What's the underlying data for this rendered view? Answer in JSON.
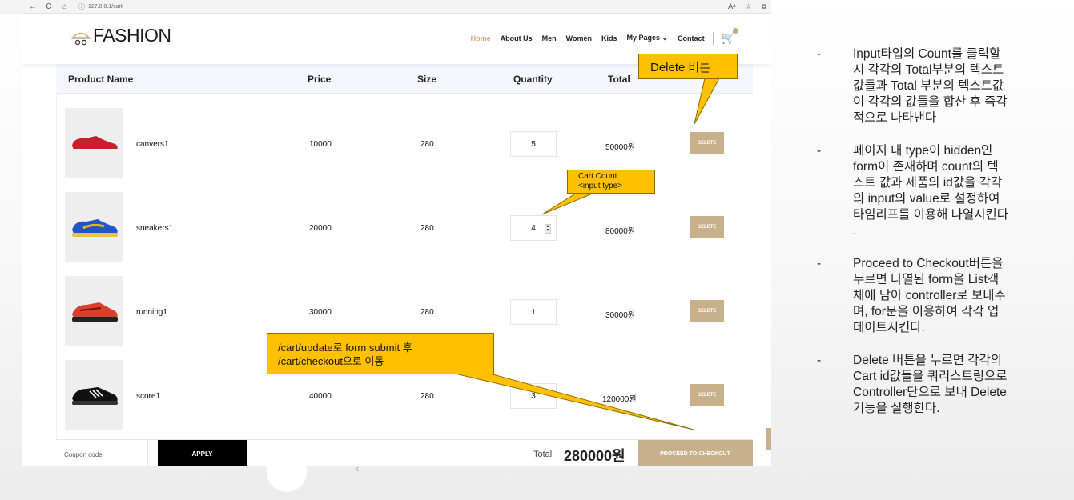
{
  "browser": {
    "url": "127.0.0.1/cart",
    "nav": [
      "←",
      "C",
      "⌂"
    ],
    "right_icons": [
      "Aᵃ",
      "☆",
      "⧉"
    ]
  },
  "header": {
    "logo": "FASHION",
    "menu": [
      "Home",
      "About Us",
      "Men",
      "Women",
      "Kids",
      "My Pages ⌄",
      "Contact"
    ],
    "active_menu": "Home"
  },
  "table": {
    "headers": [
      "Product Name",
      "Price",
      "Size",
      "Quantity",
      "Total"
    ],
    "rows": [
      {
        "name": "canvers1",
        "price": "10000",
        "size": "280",
        "qty": "5",
        "total": "50000원",
        "delete": "DELETE"
      },
      {
        "name": "sneakers1",
        "price": "20000",
        "size": "280",
        "qty": "4",
        "total": "80000원",
        "delete": "DELETE"
      },
      {
        "name": "running1",
        "price": "30000",
        "size": "280",
        "qty": "1",
        "total": "30000원",
        "delete": "DELETE"
      },
      {
        "name": "score1",
        "price": "40000",
        "size": "280",
        "qty": "3",
        "total": "120000원",
        "delete": "DELETE"
      }
    ]
  },
  "footer": {
    "coupon_placeholder": "Coupon code",
    "apply": "APPLY",
    "total_label": "Total",
    "total_value": "280000원",
    "checkout": "PROCEED TO CHECKOUT"
  },
  "callouts": {
    "delete": "Delete 버튼",
    "count_line1": "Cart Count",
    "count_line2": "<input type>",
    "submit_line1": "/cart/update로 form submit 후",
    "submit_line2": "/cart/checkout으로 이동"
  },
  "notes": [
    {
      "bullet": "-",
      "text": "Input타입의 Count를 클릭할\n시 각각의 Total부분의 텍스트\n값들과 Total 부분의 텍스트값\n이 각각의 값들을 합산 후 즉각\n적으로 나타낸다"
    },
    {
      "bullet": "-",
      "text": "페이지 내 type이 hidden인\nform이 존재하며 count의 텍\n스트 값과 제품의 id값을 각각\n의 input의 value로 설정하여\n타임리프를 이용해 나열시킨다\n."
    },
    {
      "bullet": "-",
      "text": "Proceed to Checkout버튼을\n누르면 나열된 form을 List객\n체에 담아 controller로 보내주\n며, for문을 이용하여 각각 업\n데이트시킨다."
    },
    {
      "bullet": "-",
      "text": "Delete 버튼을 누르면 각각의\nCart id값들을 쿼리스트링으로\nController단으로 보내 Delete\n기능을 실행한다."
    }
  ],
  "colors": {
    "accent": "#c9a97c",
    "callout": "#ffc000",
    "shoe_red": "#c8202a",
    "shoe_blue": "#1f57c9",
    "shoe_orange": "#d8402a",
    "shoe_black": "#111111"
  }
}
